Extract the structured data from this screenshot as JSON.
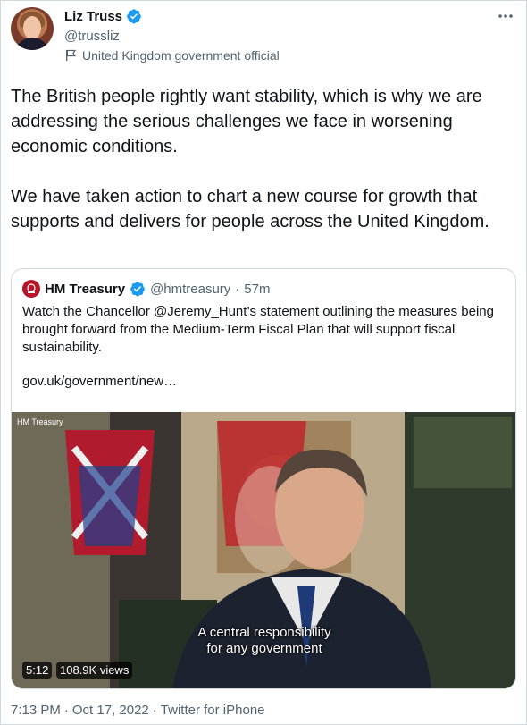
{
  "author": {
    "name": "Liz Truss",
    "handle": "@trussliz",
    "label": "United Kingdom government official"
  },
  "tweet": {
    "text": "The British people rightly want stability, which is why we are addressing the serious challenges we face in worsening economic conditions.\n\nWe have taken action to chart a new course for growth that supports and delivers for people across the United Kingdom."
  },
  "quote": {
    "name": "HM Treasury",
    "handle": "@hmtreasury",
    "time": "57m",
    "text": "Watch the Chancellor @Jeremy_Hunt’s statement outlining the measures being brought forward from the Medium-Term Fiscal Plan that will support fiscal sustainability.",
    "link": "gov.uk/government/new…",
    "video": {
      "watermark": "HM Treasury",
      "subtitle_line1": "A central responsibility",
      "subtitle_line2": "for any government",
      "duration": "5:12",
      "views": "108.9K views"
    }
  },
  "footer": {
    "time": "7:13 PM",
    "date": "Oct 17, 2022",
    "source": "Twitter for iPhone"
  },
  "colors": {
    "verified": "#1d9bf0",
    "secondary_text": "#536471",
    "border": "#cfd9de"
  },
  "icons": [
    "verified-badge-icon",
    "more-icon",
    "flag-icon",
    "crest-icon"
  ]
}
